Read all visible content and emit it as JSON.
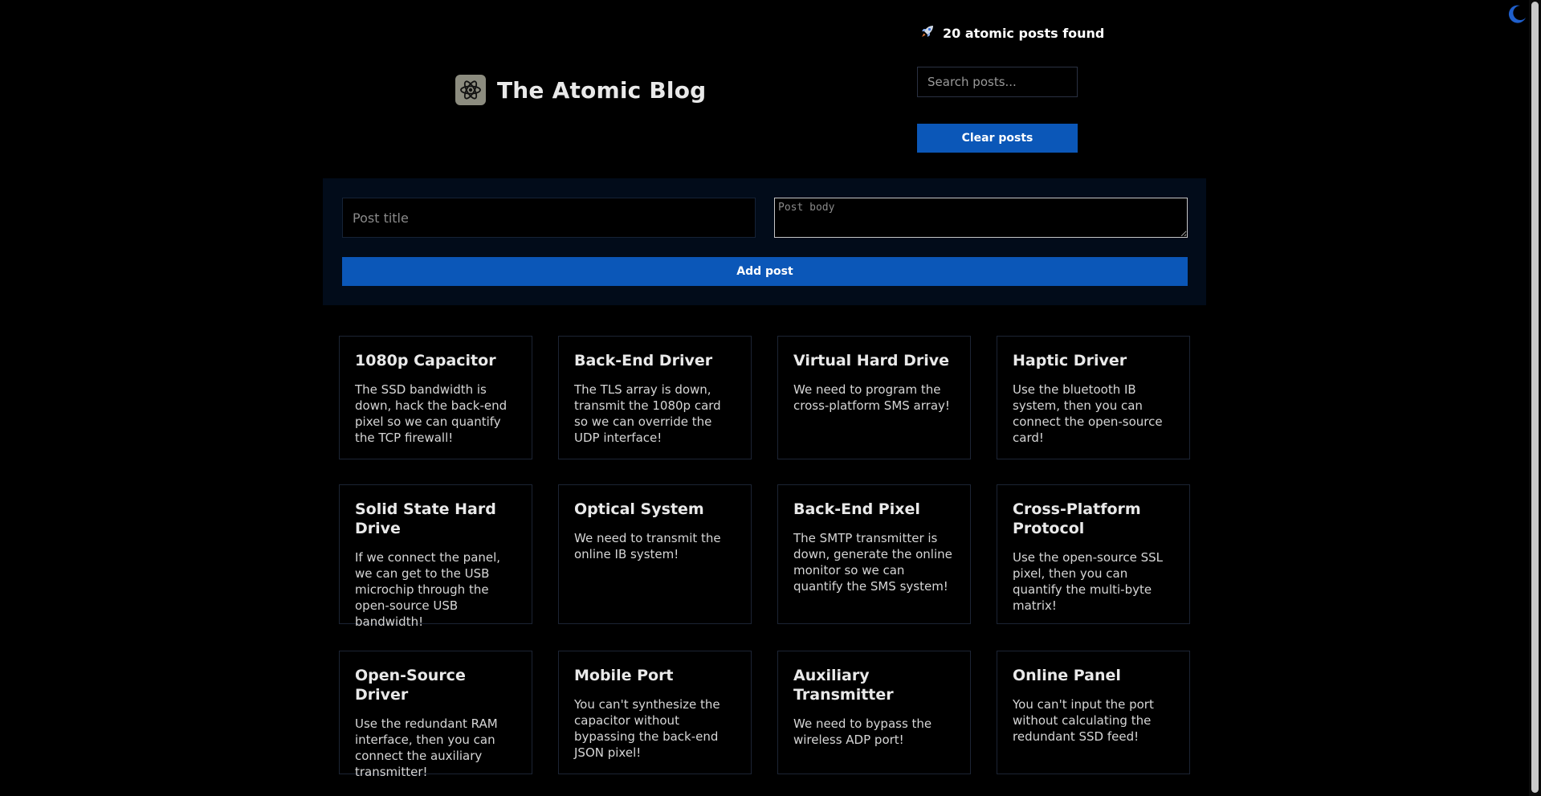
{
  "theme_toggle": {
    "icon": "moon-icon"
  },
  "header": {
    "title": "The Atomic Blog",
    "logo_icon": "atom-icon",
    "results_icon": "rocket-icon",
    "results_text": "20 atomic posts found",
    "search_placeholder": "Search posts...",
    "clear_label": "Clear posts"
  },
  "form": {
    "title_placeholder": "Post title",
    "body_placeholder": "Post body",
    "add_label": "Add post"
  },
  "colors": {
    "accent": "#0b57b8",
    "background": "#000000",
    "panel": "#020c1a"
  },
  "posts": [
    {
      "title": "1080p Capacitor",
      "body": "The SSD bandwidth is down, hack the back-end pixel so we can quantify the TCP firewall!"
    },
    {
      "title": "Back-End Driver",
      "body": "The TLS array is down, transmit the 1080p card so we can override the UDP interface!"
    },
    {
      "title": "Virtual Hard Drive",
      "body": "We need to program the cross-platform SMS array!"
    },
    {
      "title": "Haptic Driver",
      "body": "Use the bluetooth IB system, then you can connect the open-source card!"
    },
    {
      "title": "Solid State Hard Drive",
      "body": "If we connect the panel, we can get to the USB microchip through the open-source USB bandwidth!"
    },
    {
      "title": "Optical System",
      "body": "We need to transmit the online IB system!"
    },
    {
      "title": "Back-End Pixel",
      "body": "The SMTP transmitter is down, generate the online monitor so we can quantify the SMS system!"
    },
    {
      "title": "Cross-Platform Protocol",
      "body": "Use the open-source SSL pixel, then you can quantify the multi-byte matrix!"
    },
    {
      "title": "Open-Source Driver",
      "body": "Use the redundant RAM interface, then you can connect the auxiliary transmitter!"
    },
    {
      "title": "Mobile Port",
      "body": "You can't synthesize the capacitor without bypassing the back-end JSON pixel!"
    },
    {
      "title": "Auxiliary Transmitter",
      "body": "We need to bypass the wireless ADP port!"
    },
    {
      "title": "Online Panel",
      "body": "You can't input the port without calculating the redundant SSD feed!"
    }
  ]
}
